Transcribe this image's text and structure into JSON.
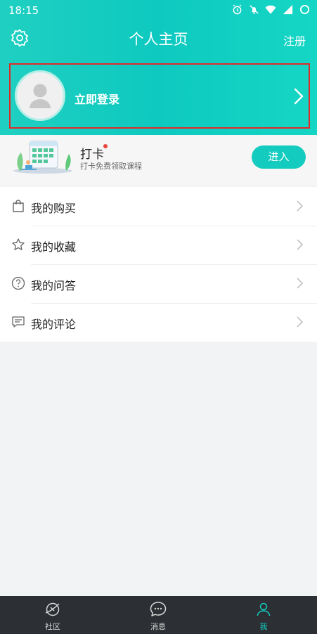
{
  "status_bar": {
    "time": "18:15",
    "icons": [
      "alarm-icon",
      "mute-icon",
      "wifi-icon",
      "signal-icon",
      "battery-icon"
    ]
  },
  "header": {
    "title": "个人主页",
    "register_label": "注册",
    "settings_icon": "gear-icon"
  },
  "login": {
    "label": "立即登录"
  },
  "checkin": {
    "title": "打卡",
    "subtitle": "打卡免费领取课程",
    "button_label": "进入"
  },
  "menu": {
    "items": [
      {
        "label": "我的购买",
        "icon": "shopping-bag-icon"
      },
      {
        "label": "我的收藏",
        "icon": "star-icon"
      },
      {
        "label": "我的问答",
        "icon": "question-icon"
      },
      {
        "label": "我的评论",
        "icon": "comment-icon"
      }
    ]
  },
  "tabbar": {
    "items": [
      {
        "label": "社区",
        "icon": "planet-icon"
      },
      {
        "label": "消息",
        "icon": "chat-bubble-icon"
      },
      {
        "label": "我",
        "icon": "profile-icon",
        "active": true
      }
    ]
  },
  "colors": {
    "accent": "#14cbbf",
    "highlight_border": "#e02a2a",
    "tabbar_bg": "#2c2f33"
  }
}
